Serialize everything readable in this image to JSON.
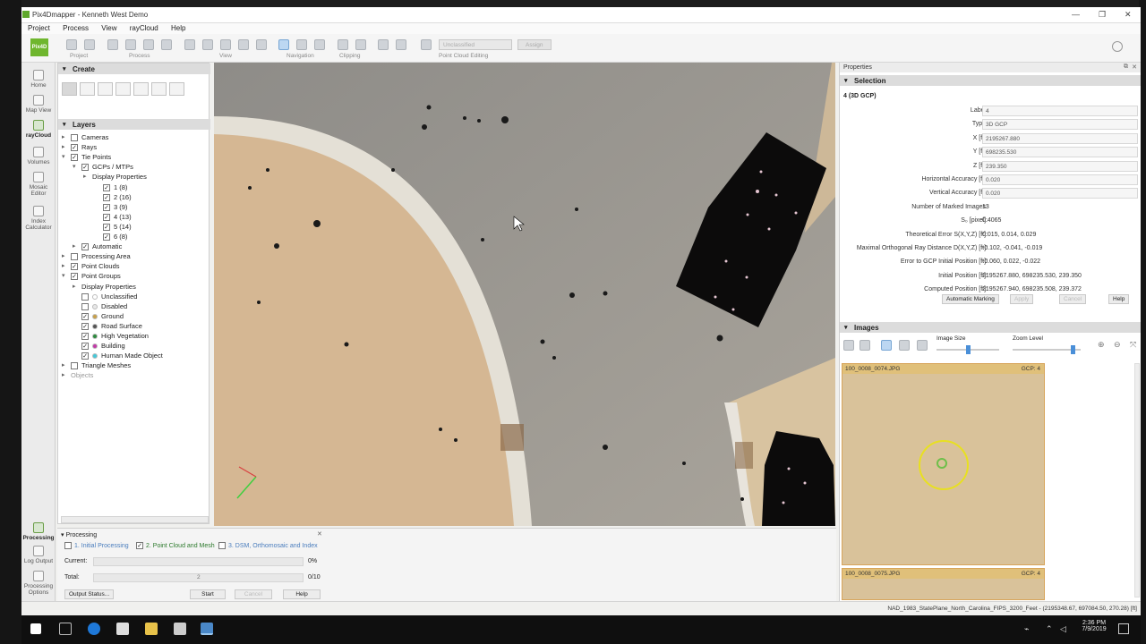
{
  "window": {
    "title": "Pix4Dmapper - Kenneth West Demo"
  },
  "menu": [
    "Project",
    "Process",
    "View",
    "rayCloud",
    "Help"
  ],
  "toolbar": {
    "groups": [
      "Project",
      "Process",
      "View",
      "Navigation",
      "Clipping",
      "Point Cloud Editing"
    ],
    "class_select": "Unclassified",
    "assign_label": "Assign"
  },
  "logo_text": "Pix4D",
  "nav": [
    {
      "label": "Home",
      "active": false
    },
    {
      "label": "Map View",
      "active": false
    },
    {
      "label": "rayCloud",
      "active": true
    },
    {
      "label": "Volumes",
      "active": false
    },
    {
      "label": "Mosaic Editor",
      "active": false
    },
    {
      "label": "Index Calculator",
      "active": false
    },
    {
      "label": "Processing",
      "active": true
    },
    {
      "label": "Log Output",
      "active": false
    },
    {
      "label": "Processing Options",
      "active": false
    }
  ],
  "create_panel": {
    "title": "Create"
  },
  "layers_panel": {
    "title": "Layers",
    "rows": [
      {
        "label": "Cameras",
        "expand": "▸",
        "checked": false,
        "level": 0
      },
      {
        "label": "Rays",
        "expand": "▸",
        "checked": true,
        "level": 0
      },
      {
        "label": "Tie Points",
        "expand": "▾",
        "checked": true,
        "level": 0
      },
      {
        "label": "GCPs / MTPs",
        "expand": "▾",
        "checked": true,
        "level": 1
      },
      {
        "label": "Display Properties",
        "expand": "▸",
        "checked": null,
        "level": 2
      },
      {
        "label": "1 (8)",
        "expand": "",
        "checked": true,
        "level": 3
      },
      {
        "label": "2 (16)",
        "expand": "",
        "checked": true,
        "level": 3
      },
      {
        "label": "3 (9)",
        "expand": "",
        "checked": true,
        "level": 3
      },
      {
        "label": "4 (13)",
        "expand": "",
        "checked": true,
        "level": 3
      },
      {
        "label": "5 (14)",
        "expand": "",
        "checked": true,
        "level": 3
      },
      {
        "label": "6 (8)",
        "expand": "",
        "checked": true,
        "level": 3
      },
      {
        "label": "Automatic",
        "expand": "▸",
        "checked": true,
        "level": 1
      },
      {
        "label": "Processing Area",
        "expand": "▸",
        "checked": false,
        "level": 0
      },
      {
        "label": "Point Clouds",
        "expand": "▸",
        "checked": true,
        "level": 0
      },
      {
        "label": "Point Groups",
        "expand": "▾",
        "checked": true,
        "level": 0
      },
      {
        "label": "Display Properties",
        "expand": "▸",
        "checked": null,
        "level": 1
      },
      {
        "label": "Unclassified",
        "expand": "",
        "checked": false,
        "level": 1,
        "dot": "#ffffff"
      },
      {
        "label": "Disabled",
        "expand": "",
        "checked": false,
        "level": 1,
        "dot": "#e8e8e8"
      },
      {
        "label": "Ground",
        "expand": "",
        "checked": true,
        "level": 1,
        "dot": "#c8a04a"
      },
      {
        "label": "Road Surface",
        "expand": "",
        "checked": true,
        "level": 1,
        "dot": "#555555"
      },
      {
        "label": "High Vegetation",
        "expand": "",
        "checked": true,
        "level": 1,
        "dot": "#2e8b3e"
      },
      {
        "label": "Building",
        "expand": "",
        "checked": true,
        "level": 1,
        "dot": "#c23aa8"
      },
      {
        "label": "Human Made Object",
        "expand": "",
        "checked": true,
        "level": 1,
        "dot": "#45c8d8"
      },
      {
        "label": "Triangle Meshes",
        "expand": "▸",
        "checked": false,
        "level": 0
      },
      {
        "label": "Objects",
        "expand": "▸",
        "checked": null,
        "level": 0,
        "dim": true
      }
    ]
  },
  "properties": {
    "panel_title": "Properties",
    "section": "Selection",
    "item": "4 (3D GCP)",
    "fields": [
      {
        "key": "Label:",
        "value": "4",
        "kind": "field"
      },
      {
        "key": "Type:",
        "value": "3D GCP",
        "kind": "field"
      },
      {
        "key": "X [ft]:",
        "value": "2195267.880",
        "kind": "field"
      },
      {
        "key": "Y [ft]:",
        "value": "698235.530",
        "kind": "field"
      },
      {
        "key": "Z [ft]:",
        "value": "239.350",
        "kind": "field"
      },
      {
        "key": "Horizontal Accuracy [ft]:",
        "value": "0.020",
        "kind": "field"
      },
      {
        "key": "Vertical Accuracy [ft]:",
        "value": "0.020",
        "kind": "field"
      },
      {
        "key": "Number of Marked Images:",
        "value": "13",
        "kind": "text"
      },
      {
        "key": "S₀ [pixel]:",
        "value": "0.4065",
        "kind": "text"
      },
      {
        "key": "Theoretical Error S(X,Y,Z) [ft]:",
        "value": "0.015, 0.014, 0.029",
        "kind": "text"
      },
      {
        "key": "Maximal Orthogonal Ray Distance D(X,Y,Z) [ft]:",
        "value": "-0.102, -0.041, -0.019",
        "kind": "text"
      },
      {
        "key": "Error to GCP Initial Position [ft]:",
        "value": "-0.060, 0.022, -0.022",
        "kind": "text"
      },
      {
        "key": "Initial Position [ft]:",
        "value": "2195267.880, 698235.530, 239.350",
        "kind": "text"
      },
      {
        "key": "Computed Position [ft]:",
        "value": "2195267.940, 698235.508, 239.372",
        "kind": "text"
      }
    ],
    "buttons": {
      "auto": "Automatic Marking",
      "apply": "Apply",
      "cancel": "Cancel",
      "help": "Help"
    }
  },
  "images": {
    "title": "Images",
    "image_size_label": "Image Size",
    "zoom_level_label": "Zoom Level",
    "cards": [
      {
        "name": "100_0008_0074.JPG",
        "gcp": "GCP: 4"
      },
      {
        "name": "100_0008_0075.JPG",
        "gcp": "GCP: 4"
      }
    ]
  },
  "processing": {
    "title": "Processing",
    "steps": [
      {
        "label": "1. Initial Processing",
        "checked": false
      },
      {
        "label": "2. Point Cloud and Mesh",
        "checked": true
      },
      {
        "label": "3. DSM, Orthomosaic and Index",
        "checked": false
      }
    ],
    "current_label": "Current:",
    "current_value": "0%",
    "current_progress": 0.0,
    "total_label": "Total:",
    "total_value": "0/10",
    "total_mid": "2",
    "total_progress": 0.0,
    "buttons": {
      "output_status": "Output Status...",
      "start": "Start",
      "cancel": "Cancel",
      "help": "Help"
    }
  },
  "statusbar": {
    "coords": "NAD_1983_StatePlane_North_Carolina_FIPS_3200_Feet - (2195348.67, 697084.50, 270.28) [ft]"
  },
  "taskbar": {
    "time": "2:36 PM",
    "date": "7/9/2019"
  },
  "colors": {
    "accent": "#6fb62e",
    "gcp_marker": "#e8e020",
    "selection_blue": "#bcd7f2"
  }
}
